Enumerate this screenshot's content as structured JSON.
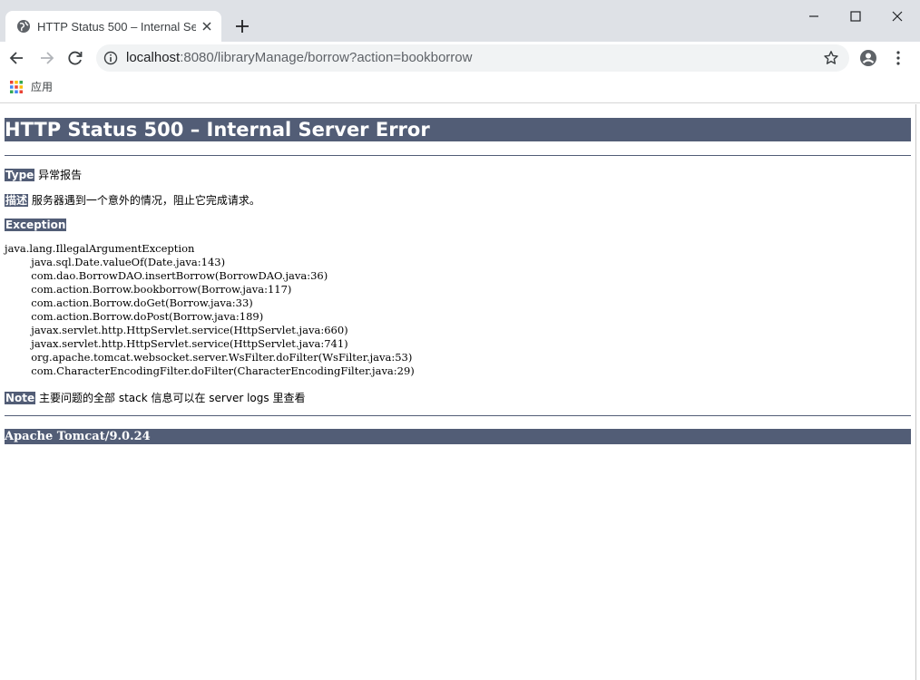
{
  "browser": {
    "tab_title": "HTTP Status 500 – Internal Server Error",
    "url_host": "localhost",
    "url_rest": ":8080/libraryManage/borrow?action=bookborrow",
    "bookmarks": {
      "apps_label": "应用"
    },
    "icons": [
      "globe-icon",
      "close-icon",
      "plus-icon",
      "minimize-icon",
      "maximize-icon",
      "close-window-icon",
      "back-arrow-icon",
      "forward-arrow-icon",
      "reload-icon",
      "info-icon",
      "star-icon",
      "profile-icon",
      "kebab-menu-icon",
      "apps-grid-icon"
    ]
  },
  "page": {
    "title": "HTTP Status 500 – Internal Server Error",
    "type_label": "Type",
    "type_value": "异常报告",
    "desc_label": "描述",
    "desc_value": "服务器遇到一个意外的情况，阻止它完成请求。",
    "exception_label": "Exception",
    "stack_trace": [
      "java.lang.IllegalArgumentException",
      "\tjava.sql.Date.valueOf(Date.java:143)",
      "\tcom.dao.BorrowDAO.insertBorrow(BorrowDAO.java:36)",
      "\tcom.action.Borrow.bookborrow(Borrow.java:117)",
      "\tcom.action.Borrow.doGet(Borrow.java:33)",
      "\tcom.action.Borrow.doPost(Borrow.java:189)",
      "\tjavax.servlet.http.HttpServlet.service(HttpServlet.java:660)",
      "\tjavax.servlet.http.HttpServlet.service(HttpServlet.java:741)",
      "\torg.apache.tomcat.websocket.server.WsFilter.doFilter(WsFilter.java:53)",
      "\tcom.CharacterEncodingFilter.doFilter(CharacterEncodingFilter.java:29)"
    ],
    "note_label": "Note",
    "note_value": "主要问题的全部 stack 信息可以在 server logs 里查看",
    "footer": "Apache Tomcat/9.0.24"
  },
  "colors": {
    "tomcat_bar": "#525d76",
    "tabstrip": "#dee1e6",
    "omnibox": "#f1f3f4"
  }
}
